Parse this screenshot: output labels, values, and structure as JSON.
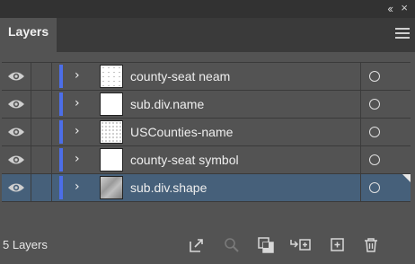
{
  "panel": {
    "tab_label": "Layers",
    "collapse_glyph": "‹‹",
    "close_glyph": "×",
    "footer_count": "5 Layers"
  },
  "layers": [
    {
      "name": "county-seat neam",
      "thumb": "light-speckle",
      "selected": false
    },
    {
      "name": "sub.div.name",
      "thumb": "blank",
      "selected": false
    },
    {
      "name": "USCounties-name",
      "thumb": "speckle",
      "selected": false
    },
    {
      "name": "county-seat symbol",
      "thumb": "blank",
      "selected": false
    },
    {
      "name": "sub.div.shape",
      "thumb": "map",
      "selected": true
    }
  ],
  "colors": {
    "panel_bg": "#535353",
    "selected_row": "#46607a",
    "layer_color": "#4c6ee8"
  },
  "footer_icons": [
    "export-icon",
    "search-icon",
    "clipping-mask-icon",
    "move-to-layer-icon",
    "new-sublayer-icon",
    "delete-icon"
  ]
}
